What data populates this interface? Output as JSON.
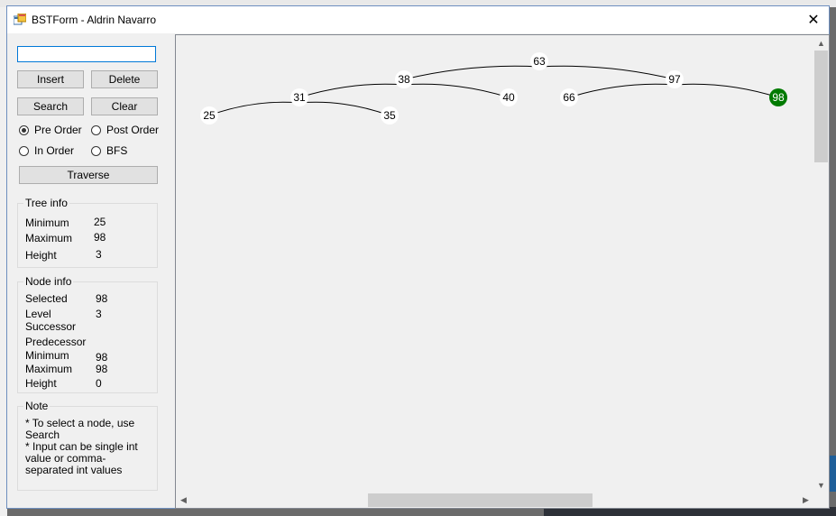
{
  "window": {
    "title": "BSTForm - Aldrin Navarro",
    "close_glyph": "✕",
    "icon": "app-form-icon"
  },
  "controls": {
    "input_value": "",
    "insert_label": "Insert",
    "delete_label": "Delete",
    "search_label": "Search",
    "clear_label": "Clear",
    "radio_preorder": "Pre Order",
    "radio_postorder": "Post Order",
    "radio_inorder": "In Order",
    "radio_bfs": "BFS",
    "selected_traversal": "Pre Order",
    "traverse_label": "Traverse"
  },
  "tree_info": {
    "title": "Tree info",
    "minimum_label": "Minimum",
    "minimum_value": "25",
    "maximum_label": "Maximum",
    "maximum_value": "98",
    "height_label": "Height",
    "height_value": "3"
  },
  "node_info": {
    "title": "Node info",
    "selected_label": "Selected",
    "selected_value": "98",
    "level_label": "Level",
    "level_value": "3",
    "successor_label": "Successor",
    "successor_value": "",
    "predecessor_label": "Predecessor",
    "predecessor_value": "",
    "minimum_label": "Minimum",
    "minimum_value": "98",
    "maximum_label": "Maximum",
    "maximum_value": "98",
    "height_label": "Height",
    "height_value": "0"
  },
  "note": {
    "title": "Note",
    "line1": "* To select a node, use Search",
    "line2": "* Input can be single int value or comma-separated int values"
  },
  "tree": {
    "selected_color": "#007a00",
    "nodes": [
      {
        "id": "63",
        "label": "63",
        "level": 0
      },
      {
        "id": "38",
        "label": "38",
        "level": 1,
        "parent": "63"
      },
      {
        "id": "97",
        "label": "97",
        "level": 1,
        "parent": "63"
      },
      {
        "id": "31",
        "label": "31",
        "level": 2,
        "parent": "38"
      },
      {
        "id": "40",
        "label": "40",
        "level": 2,
        "parent": "38"
      },
      {
        "id": "66",
        "label": "66",
        "level": 2,
        "parent": "97"
      },
      {
        "id": "98",
        "label": "98",
        "level": 2,
        "parent": "97",
        "selected": true
      },
      {
        "id": "25",
        "label": "25",
        "level": 3,
        "parent": "31"
      },
      {
        "id": "35",
        "label": "35",
        "level": 3,
        "parent": "31"
      }
    ]
  },
  "scrollbars": {
    "up": "▲",
    "down": "▼",
    "left": "◀",
    "right": "▶"
  }
}
